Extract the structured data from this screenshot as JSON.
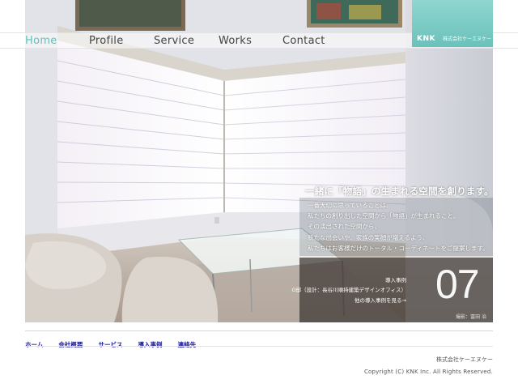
{
  "nav": {
    "items": [
      {
        "label": "Home",
        "active": true
      },
      {
        "label": "Profile",
        "active": false
      },
      {
        "label": "Service",
        "active": false
      },
      {
        "label": "Works",
        "active": false
      },
      {
        "label": "Contact",
        "active": false
      }
    ]
  },
  "logo": {
    "mark": "KNK",
    "company": "株式会社ケーエヌケー",
    "color": "#7ccbc3"
  },
  "hero": {
    "tagline": "一緒に「物語」の生まれる空間を創ります。",
    "lines": [
      "一番大切に思っていることは、",
      "私たちの創り出した空間から「物語」が生まれること。",
      "その演出された空間から、",
      "新たな出会いや、家族の笑顔が増えるよう、",
      "私たちはお客様だけのトータル・コーディネートをご提案します。"
    ],
    "case": {
      "label": "導入事例",
      "title": "O邸（設計：長谷川順持建築デザインオフィス）",
      "more": "他の導入事例を見る→",
      "number": "07",
      "credit": "撮影：冨田 治"
    }
  },
  "footer": {
    "links": [
      "ホーム",
      "会社概要",
      "サービス",
      "導入事例",
      "連絡先"
    ],
    "company": "株式会社ケーエヌケー",
    "copyright": "Copyright (C) KNK Inc. All Rights Reserved.",
    "link_color": "#1a1a9a"
  },
  "colors": {
    "accent": "#5fc4b8",
    "panel": "#3c3430"
  }
}
